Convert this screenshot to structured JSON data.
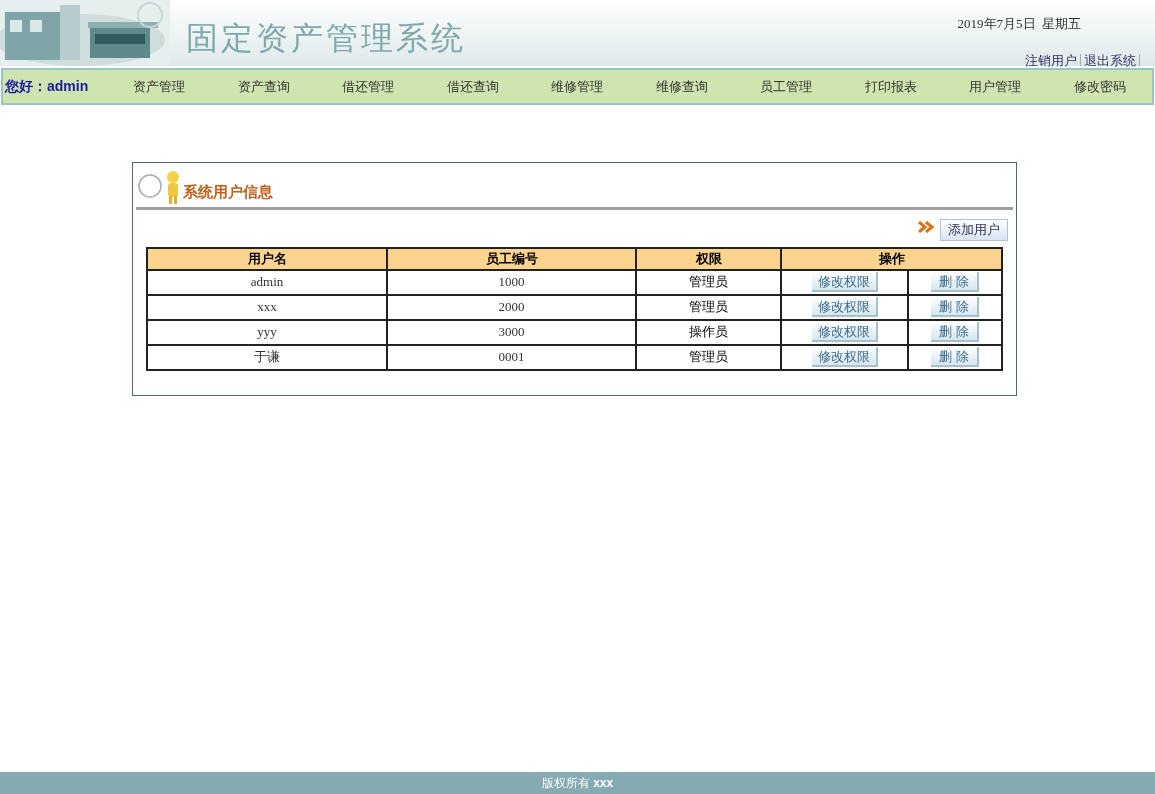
{
  "header": {
    "title": "固定资产管理系统",
    "date": "2019年7月5日  星期五",
    "links": [
      "注销用户",
      "退出系统"
    ]
  },
  "nav": {
    "greeting": "您好：admin",
    "items": [
      "资产管理",
      "资产查询",
      "借还管理",
      "借还查询",
      "维修管理",
      "维修查询",
      "员工管理",
      "打印报表",
      "用户管理",
      "修改密码"
    ]
  },
  "panel": {
    "title": "系统用户信息",
    "add_button": "添加用户",
    "table": {
      "columns": [
        "用户名",
        "员工编号",
        "权限",
        "操作"
      ],
      "rows": [
        {
          "username": "admin",
          "employee_id": "1000",
          "role": "管理员",
          "edit_button": "修改权限",
          "delete_button": "删 除"
        },
        {
          "username": "xxx",
          "employee_id": "2000",
          "role": "管理员",
          "edit_button": "修改权限",
          "delete_button": "删 除"
        },
        {
          "username": "yyy",
          "employee_id": "3000",
          "role": "操作员",
          "edit_button": "修改权限",
          "delete_button": "删 除"
        },
        {
          "username": "于谦",
          "employee_id": "0001",
          "role": "管理员",
          "edit_button": "修改权限",
          "delete_button": "删 除"
        }
      ]
    }
  },
  "footer": {
    "text": "版权所有 **xxx**"
  }
}
